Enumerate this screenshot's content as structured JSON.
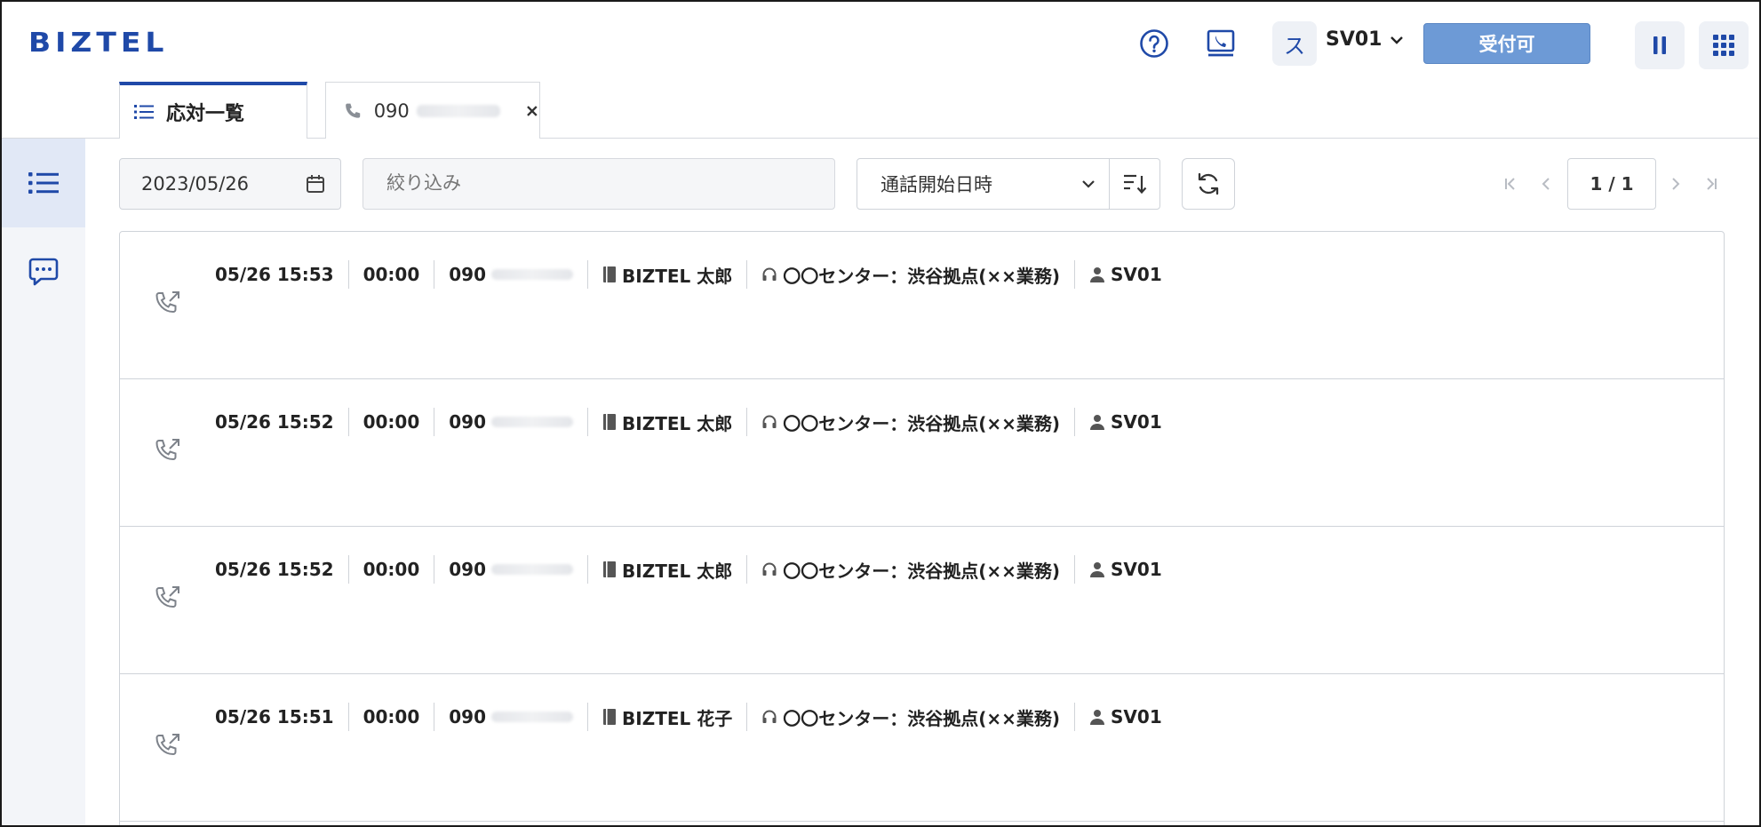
{
  "header": {
    "logo": "BIZTEL",
    "help_icon": "help-circle-icon",
    "phone_screen_icon": "softphone-icon",
    "user_initial": "ス",
    "user_name": "SV01",
    "status_button": "受付可",
    "pause_icon": "pause-icon",
    "apps_icon": "grid-menu-icon",
    "accent_color": "#1f49a8",
    "status_color": "#6d9ad6"
  },
  "tabs": [
    {
      "label": "応対一覧",
      "icon": "list-icon",
      "active": true
    },
    {
      "label": "090",
      "icon": "phone-icon",
      "active": false
    }
  ],
  "rail": [
    {
      "icon": "list-icon",
      "active": true
    },
    {
      "icon": "chat-icon",
      "active": false
    }
  ],
  "toolbar": {
    "date_value": "2023/05/26",
    "filter_placeholder": "絞り込み",
    "sort_value": "通話開始日時",
    "page_label": "1 / 1"
  },
  "rows": [
    {
      "datetime": "05/26 15:53",
      "duration": "00:00",
      "phone": "090",
      "contact": "BIZTEL 太郎",
      "queue": "〇〇センター：渋谷拠点(××業務)",
      "agent": "SV01"
    },
    {
      "datetime": "05/26 15:52",
      "duration": "00:00",
      "phone": "090",
      "contact": "BIZTEL 太郎",
      "queue": "〇〇センター：渋谷拠点(××業務)",
      "agent": "SV01"
    },
    {
      "datetime": "05/26 15:52",
      "duration": "00:00",
      "phone": "090",
      "contact": "BIZTEL 太郎",
      "queue": "〇〇センター：渋谷拠点(××業務)",
      "agent": "SV01"
    },
    {
      "datetime": "05/26 15:51",
      "duration": "00:00",
      "phone": "090",
      "contact": "BIZTEL 花子",
      "queue": "〇〇センター：渋谷拠点(××業務)",
      "agent": "SV01"
    }
  ]
}
